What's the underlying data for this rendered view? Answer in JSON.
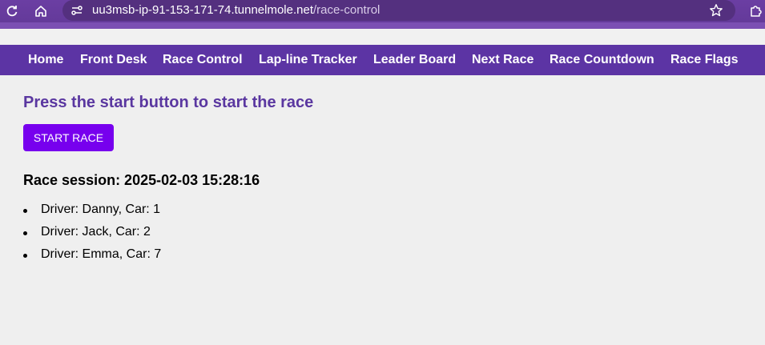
{
  "browser": {
    "url_host": "uu3msb-ip-91-153-171-74.tunnelmole.net",
    "url_path": "/race-control",
    "icons": [
      "reload-icon",
      "home-icon",
      "site-info-icon",
      "bookmark-star-icon",
      "extensions-icon"
    ]
  },
  "nav": {
    "items": [
      {
        "label": "Home"
      },
      {
        "label": "Front Desk"
      },
      {
        "label": "Race Control"
      },
      {
        "label": "Lap-line Tracker"
      },
      {
        "label": "Leader Board"
      },
      {
        "label": "Next Race"
      },
      {
        "label": "Race Countdown"
      },
      {
        "label": "Race Flags"
      }
    ]
  },
  "main": {
    "heading": "Press the start button to start the race",
    "start_button_label": "START RACE",
    "session_title": "Race session: 2025-02-03 15:28:16",
    "drivers": [
      {
        "text": "Driver: Danny, Car: 1"
      },
      {
        "text": "Driver: Jack, Car: 2"
      },
      {
        "text": "Driver: Emma, Car: 7"
      }
    ]
  },
  "colors": {
    "nav_bg": "#5c34a4",
    "heading": "#5a37a0",
    "button_bg": "#7700ee",
    "page_bg": "#efefef"
  }
}
